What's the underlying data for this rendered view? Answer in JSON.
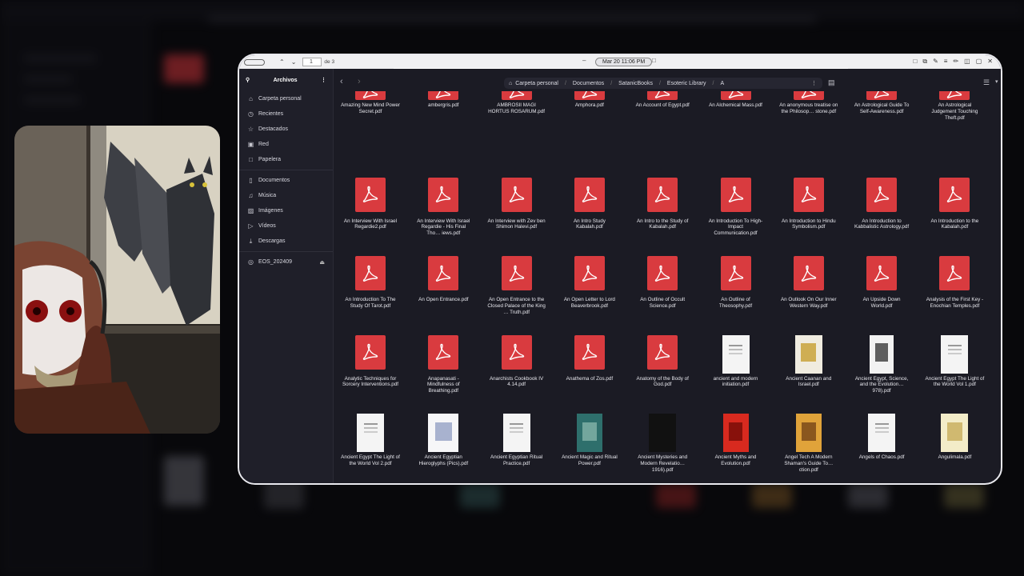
{
  "viewer": {
    "page_number": "1",
    "page_total": "de 3",
    "clock": "Mar 20  11:06 PM"
  },
  "sidebar": {
    "title": "Archivos",
    "items": [
      {
        "label": "Carpeta personal",
        "icon": "home-icon"
      },
      {
        "label": "Recientes",
        "icon": "clock-icon"
      },
      {
        "label": "Destacados",
        "icon": "star-icon"
      },
      {
        "label": "Red",
        "icon": "network-icon"
      },
      {
        "label": "Papelera",
        "icon": "trash-icon"
      }
    ],
    "places": [
      {
        "label": "Documentos",
        "icon": "document-icon"
      },
      {
        "label": "Música",
        "icon": "music-icon"
      },
      {
        "label": "Imágenes",
        "icon": "image-icon"
      },
      {
        "label": "Vídeos",
        "icon": "video-icon"
      },
      {
        "label": "Descargas",
        "icon": "download-icon"
      }
    ],
    "devices": [
      {
        "label": "EOS_202409",
        "icon": "disk-icon"
      }
    ]
  },
  "path": {
    "home": "Carpeta personal",
    "segments": [
      "Documentos",
      "SatanicBooks",
      "Esoteric Library",
      "A"
    ]
  },
  "files": [
    {
      "name": "Amazing New Mind Power Secret.pdf",
      "thumb": "pdf"
    },
    {
      "name": "ambergris.pdf",
      "thumb": "pdf"
    },
    {
      "name": "AMBROSII MAGI HORTUS ROSARUM.pdf",
      "thumb": "pdf"
    },
    {
      "name": "Amphora.pdf",
      "thumb": "pdf"
    },
    {
      "name": "An Account of Egypt.pdf",
      "thumb": "pdf"
    },
    {
      "name": "An Alchemical Mass.pdf",
      "thumb": "pdf"
    },
    {
      "name": "An anonymous treatise on the Philosop… stone.pdf",
      "thumb": "pdf"
    },
    {
      "name": "An Astrological Guide To Self-Awareness.pdf",
      "thumb": "pdf"
    },
    {
      "name": "An Astrological Judgement Touching Theft.pdf",
      "thumb": "pdf"
    },
    {
      "name": "An Interview With Israel Regardie2.pdf",
      "thumb": "pdf"
    },
    {
      "name": "An Interview With Israel Regardie - His Final Tho… iews.pdf",
      "thumb": "pdf"
    },
    {
      "name": "An Interview with Zev ben Shimon Halevi.pdf",
      "thumb": "pdf"
    },
    {
      "name": "An Intro Study Kabalah.pdf",
      "thumb": "pdf"
    },
    {
      "name": "An Intro to the Study of Kabalah.pdf",
      "thumb": "pdf"
    },
    {
      "name": "An Introduction To High-Impact Communication.pdf",
      "thumb": "pdf"
    },
    {
      "name": "An Introduction to Hindu Symbolism.pdf",
      "thumb": "pdf"
    },
    {
      "name": "An Introduction to Kabbalistic Astrology.pdf",
      "thumb": "pdf"
    },
    {
      "name": "An Introduction to the Kabalah.pdf",
      "thumb": "pdf"
    },
    {
      "name": "An Introduction To The Study Of Tarot.pdf",
      "thumb": "pdf"
    },
    {
      "name": "An Open Entrance.pdf",
      "thumb": "pdf"
    },
    {
      "name": "An Open Entrance to the Closed Palace of the King … Truth.pdf",
      "thumb": "pdf"
    },
    {
      "name": "An Open Letter to Lord Beaverbrook.pdf",
      "thumb": "pdf"
    },
    {
      "name": "An Outline of Occult Science.pdf",
      "thumb": "pdf"
    },
    {
      "name": "An Outline of Theosophy.pdf",
      "thumb": "pdf"
    },
    {
      "name": "An Outlook On Our Inner Western Way.pdf",
      "thumb": "pdf"
    },
    {
      "name": "An Upside Down World.pdf",
      "thumb": "pdf"
    },
    {
      "name": "Analysis of the First Key - Enochian Temples.pdf",
      "thumb": "pdf"
    },
    {
      "name": "Analytic Techniques for Sorcery Interventions.pdf",
      "thumb": "pdf"
    },
    {
      "name": "Anapanasati - Mindfulness of Breathing.pdf",
      "thumb": "pdf"
    },
    {
      "name": "Anarchists Cookbook IV 4.14.pdf",
      "thumb": "pdf"
    },
    {
      "name": "Anathema of Zos.pdf",
      "thumb": "pdf"
    },
    {
      "name": "Anatomy of the Body of God.pdf",
      "thumb": "pdf"
    },
    {
      "name": "ancient and modern initiation.pdf",
      "thumb": "page-white"
    },
    {
      "name": "Ancient Caanan and Israel.pdf",
      "thumb": "page-cover"
    },
    {
      "name": "Ancient Egypt, Science, and the Evolution… 978).pdf",
      "thumb": "page-figure"
    },
    {
      "name": "Ancient Egypt The Light of the World Vol 1.pdf",
      "thumb": "page-white"
    },
    {
      "name": "Ancient Egypt The Light of the World Vol 2.pdf",
      "thumb": "page-white"
    },
    {
      "name": "Ancient Egyptian Hieroglyphs (Pics).pdf",
      "thumb": "page-table"
    },
    {
      "name": "Ancient Egyptian Ritual Practice.pdf",
      "thumb": "page-white"
    },
    {
      "name": "Ancient Magic and Ritual Power.pdf",
      "thumb": "cover-teal"
    },
    {
      "name": "Ancient Mysteries and Modern Revelatio… 1916).pdf",
      "thumb": "cover-black"
    },
    {
      "name": "Ancient Myths and Evolution.pdf",
      "thumb": "cover-red"
    },
    {
      "name": "Angel Tech A Modern Shaman's Guide To… ction.pdf",
      "thumb": "cover-orange"
    },
    {
      "name": "Angels of Chaos.pdf",
      "thumb": "page-white"
    },
    {
      "name": "Angulimala.pdf",
      "thumb": "cover-cream"
    },
    {
      "name": "",
      "thumb": "partial-white"
    },
    {
      "name": "",
      "thumb": "partial-cream"
    },
    {
      "name": "",
      "thumb": "partial-white"
    },
    {
      "name": "",
      "thumb": "partial-dark"
    },
    {
      "name": "",
      "thumb": "partial-white"
    },
    {
      "name": "",
      "thumb": "partial-white"
    },
    {
      "name": "",
      "thumb": "partial-white"
    },
    {
      "name": "",
      "thumb": "partial-black"
    },
    {
      "name": "",
      "thumb": "partial-blue"
    }
  ]
}
